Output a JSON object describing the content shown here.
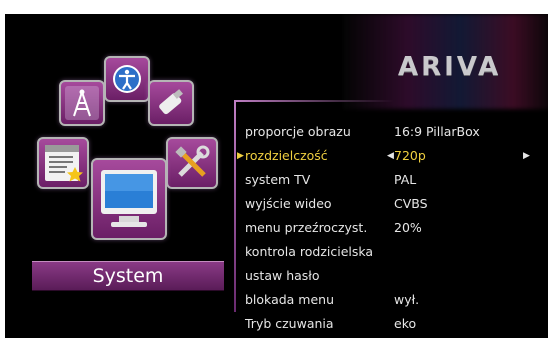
{
  "brand": {
    "logo_text": "ARIVA"
  },
  "sidebar": {
    "current_section": "System",
    "icons": [
      "antenna-icon",
      "accessibility-icon",
      "usb-stick-icon",
      "channel-list-icon",
      "tools-icon",
      "monitor-icon"
    ]
  },
  "menu": {
    "items": [
      {
        "label": "proporcje obrazu",
        "value": "16:9 PillarBox"
      },
      {
        "label": "rozdzielczość",
        "value": "720p",
        "selected": true
      },
      {
        "label": "system TV",
        "value": "PAL"
      },
      {
        "label": "wyjście wideo",
        "value": "CVBS"
      },
      {
        "label": "menu przeźroczyst.",
        "value": "20%"
      },
      {
        "label": "kontrola rodzicielska",
        "value": ""
      },
      {
        "label": "ustaw hasło",
        "value": ""
      },
      {
        "label": "blokada menu",
        "value": "wył."
      },
      {
        "label": "Tryb czuwania",
        "value": "eko"
      }
    ]
  },
  "colors": {
    "accent_selected": "#f0d040",
    "panel_purple": "#7a2a78"
  }
}
